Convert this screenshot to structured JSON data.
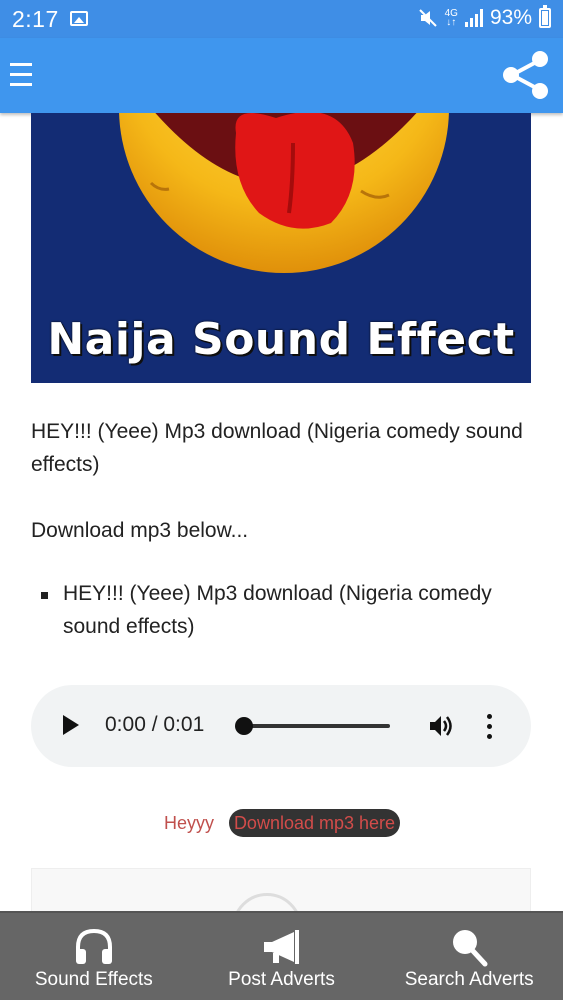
{
  "status_bar": {
    "time": "2:17",
    "network_type": "4G",
    "battery": "93%"
  },
  "app_bar": {
    "menu_icon": "hamburger-menu-icon",
    "share_icon": "share-icon"
  },
  "hero": {
    "title": "Naija Sound Effect"
  },
  "post": {
    "title": "HEY!!! (Yeee) Mp3 download (Nigeria comedy sound effects)",
    "download_intro": "Download mp3 below...",
    "tracks": [
      "HEY!!! (Yeee) Mp3 download (Nigeria comedy sound effects)"
    ]
  },
  "audio_player": {
    "time": "0:00 / 0:01",
    "progress": 0
  },
  "download": {
    "label": "Heyyy",
    "button_label": "Download mp3 here"
  },
  "bottom_nav": {
    "items": [
      {
        "label": "Sound Effects",
        "icon": "headphones-icon"
      },
      {
        "label": "Post Adverts",
        "icon": "megaphone-icon"
      },
      {
        "label": "Search Adverts",
        "icon": "search-icon"
      }
    ]
  },
  "colors": {
    "app_bar": "#3f96ee",
    "status_bar": "#3f8ee6",
    "hero_background": "#132c74",
    "download_text": "#d24c4a",
    "bottom_nav": "#666666"
  }
}
